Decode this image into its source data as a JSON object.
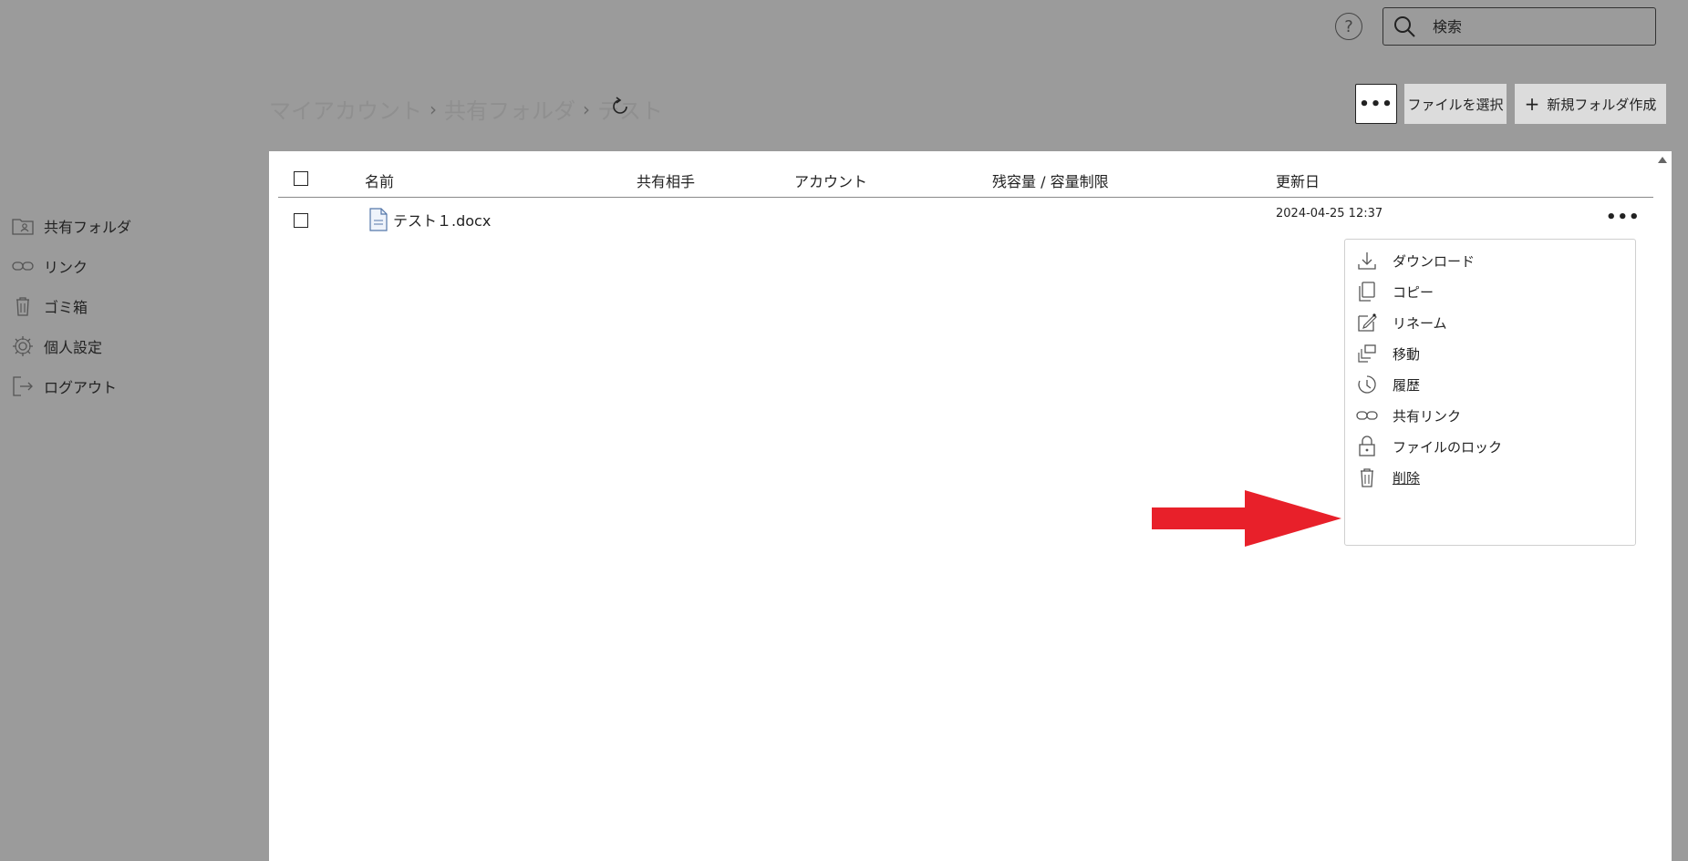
{
  "topbar": {
    "help_icon": "question-circle-icon",
    "search": {
      "placeholder": "検索",
      "icon": "search-icon"
    }
  },
  "sidebar": {
    "items": [
      {
        "label": "共有フォルダ",
        "icon": "shared-folder-icon"
      },
      {
        "label": "リンク",
        "icon": "link-icon"
      },
      {
        "label": "ゴミ箱",
        "icon": "trash-icon"
      },
      {
        "label": "個人設定",
        "icon": "gear-icon"
      },
      {
        "label": "ログアウト",
        "icon": "logout-icon"
      }
    ]
  },
  "breadcrumb": {
    "items": [
      "マイアカウント",
      "共有フォルダ",
      "テスト"
    ],
    "separator": "›"
  },
  "toolbar": {
    "more_label": "•••",
    "select_file_label": "ファイルを選択",
    "new_folder_plus": "+",
    "new_folder_label": "新規フォルダ作成"
  },
  "table": {
    "columns": [
      "名前",
      "共有相手",
      "アカウント",
      "残容量 / 容量制限",
      "更新日"
    ],
    "rows": [
      {
        "name": "テスト１.docx",
        "shared_with": "",
        "account": "",
        "quota": "",
        "updated": "2024-04-25 12:37",
        "icon": "word-document-icon"
      }
    ],
    "row_more_label": "•••"
  },
  "context_menu": {
    "items": [
      {
        "label": "ダウンロード",
        "icon": "download-icon"
      },
      {
        "label": "コピー",
        "icon": "copy-icon"
      },
      {
        "label": "リネーム",
        "icon": "rename-icon"
      },
      {
        "label": "移動",
        "icon": "move-icon"
      },
      {
        "label": "履歴",
        "icon": "history-icon"
      },
      {
        "label": "共有リンク",
        "icon": "link-icon"
      },
      {
        "label": "ファイルのロック",
        "icon": "lock-icon"
      },
      {
        "label": "削除",
        "icon": "trash-icon"
      }
    ]
  },
  "colors": {
    "overlay_gray": "#9b9b9b",
    "panel_white": "#ffffff",
    "button_gray": "#dcdcdc",
    "annotation_arrow": "#e8202a"
  }
}
